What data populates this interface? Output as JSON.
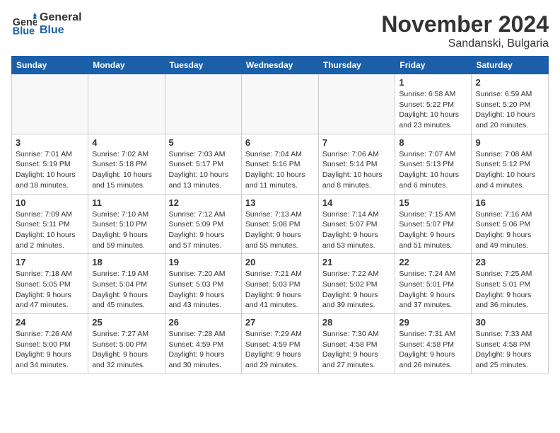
{
  "logo": {
    "text_general": "General",
    "text_blue": "Blue"
  },
  "header": {
    "month": "November 2024",
    "location": "Sandanski, Bulgaria"
  },
  "weekdays": [
    "Sunday",
    "Monday",
    "Tuesday",
    "Wednesday",
    "Thursday",
    "Friday",
    "Saturday"
  ],
  "weeks": [
    [
      {
        "day": "",
        "info": ""
      },
      {
        "day": "",
        "info": ""
      },
      {
        "day": "",
        "info": ""
      },
      {
        "day": "",
        "info": ""
      },
      {
        "day": "",
        "info": ""
      },
      {
        "day": "1",
        "info": "Sunrise: 6:58 AM\nSunset: 5:22 PM\nDaylight: 10 hours and 23 minutes."
      },
      {
        "day": "2",
        "info": "Sunrise: 6:59 AM\nSunset: 5:20 PM\nDaylight: 10 hours and 20 minutes."
      }
    ],
    [
      {
        "day": "3",
        "info": "Sunrise: 7:01 AM\nSunset: 5:19 PM\nDaylight: 10 hours and 18 minutes."
      },
      {
        "day": "4",
        "info": "Sunrise: 7:02 AM\nSunset: 5:18 PM\nDaylight: 10 hours and 15 minutes."
      },
      {
        "day": "5",
        "info": "Sunrise: 7:03 AM\nSunset: 5:17 PM\nDaylight: 10 hours and 13 minutes."
      },
      {
        "day": "6",
        "info": "Sunrise: 7:04 AM\nSunset: 5:16 PM\nDaylight: 10 hours and 11 minutes."
      },
      {
        "day": "7",
        "info": "Sunrise: 7:06 AM\nSunset: 5:14 PM\nDaylight: 10 hours and 8 minutes."
      },
      {
        "day": "8",
        "info": "Sunrise: 7:07 AM\nSunset: 5:13 PM\nDaylight: 10 hours and 6 minutes."
      },
      {
        "day": "9",
        "info": "Sunrise: 7:08 AM\nSunset: 5:12 PM\nDaylight: 10 hours and 4 minutes."
      }
    ],
    [
      {
        "day": "10",
        "info": "Sunrise: 7:09 AM\nSunset: 5:11 PM\nDaylight: 10 hours and 2 minutes."
      },
      {
        "day": "11",
        "info": "Sunrise: 7:10 AM\nSunset: 5:10 PM\nDaylight: 9 hours and 59 minutes."
      },
      {
        "day": "12",
        "info": "Sunrise: 7:12 AM\nSunset: 5:09 PM\nDaylight: 9 hours and 57 minutes."
      },
      {
        "day": "13",
        "info": "Sunrise: 7:13 AM\nSunset: 5:08 PM\nDaylight: 9 hours and 55 minutes."
      },
      {
        "day": "14",
        "info": "Sunrise: 7:14 AM\nSunset: 5:07 PM\nDaylight: 9 hours and 53 minutes."
      },
      {
        "day": "15",
        "info": "Sunrise: 7:15 AM\nSunset: 5:07 PM\nDaylight: 9 hours and 51 minutes."
      },
      {
        "day": "16",
        "info": "Sunrise: 7:16 AM\nSunset: 5:06 PM\nDaylight: 9 hours and 49 minutes."
      }
    ],
    [
      {
        "day": "17",
        "info": "Sunrise: 7:18 AM\nSunset: 5:05 PM\nDaylight: 9 hours and 47 minutes."
      },
      {
        "day": "18",
        "info": "Sunrise: 7:19 AM\nSunset: 5:04 PM\nDaylight: 9 hours and 45 minutes."
      },
      {
        "day": "19",
        "info": "Sunrise: 7:20 AM\nSunset: 5:03 PM\nDaylight: 9 hours and 43 minutes."
      },
      {
        "day": "20",
        "info": "Sunrise: 7:21 AM\nSunset: 5:03 PM\nDaylight: 9 hours and 41 minutes."
      },
      {
        "day": "21",
        "info": "Sunrise: 7:22 AM\nSunset: 5:02 PM\nDaylight: 9 hours and 39 minutes."
      },
      {
        "day": "22",
        "info": "Sunrise: 7:24 AM\nSunset: 5:01 PM\nDaylight: 9 hours and 37 minutes."
      },
      {
        "day": "23",
        "info": "Sunrise: 7:25 AM\nSunset: 5:01 PM\nDaylight: 9 hours and 36 minutes."
      }
    ],
    [
      {
        "day": "24",
        "info": "Sunrise: 7:26 AM\nSunset: 5:00 PM\nDaylight: 9 hours and 34 minutes."
      },
      {
        "day": "25",
        "info": "Sunrise: 7:27 AM\nSunset: 5:00 PM\nDaylight: 9 hours and 32 minutes."
      },
      {
        "day": "26",
        "info": "Sunrise: 7:28 AM\nSunset: 4:59 PM\nDaylight: 9 hours and 30 minutes."
      },
      {
        "day": "27",
        "info": "Sunrise: 7:29 AM\nSunset: 4:59 PM\nDaylight: 9 hours and 29 minutes."
      },
      {
        "day": "28",
        "info": "Sunrise: 7:30 AM\nSunset: 4:58 PM\nDaylight: 9 hours and 27 minutes."
      },
      {
        "day": "29",
        "info": "Sunrise: 7:31 AM\nSunset: 4:58 PM\nDaylight: 9 hours and 26 minutes."
      },
      {
        "day": "30",
        "info": "Sunrise: 7:33 AM\nSunset: 4:58 PM\nDaylight: 9 hours and 25 minutes."
      }
    ]
  ]
}
